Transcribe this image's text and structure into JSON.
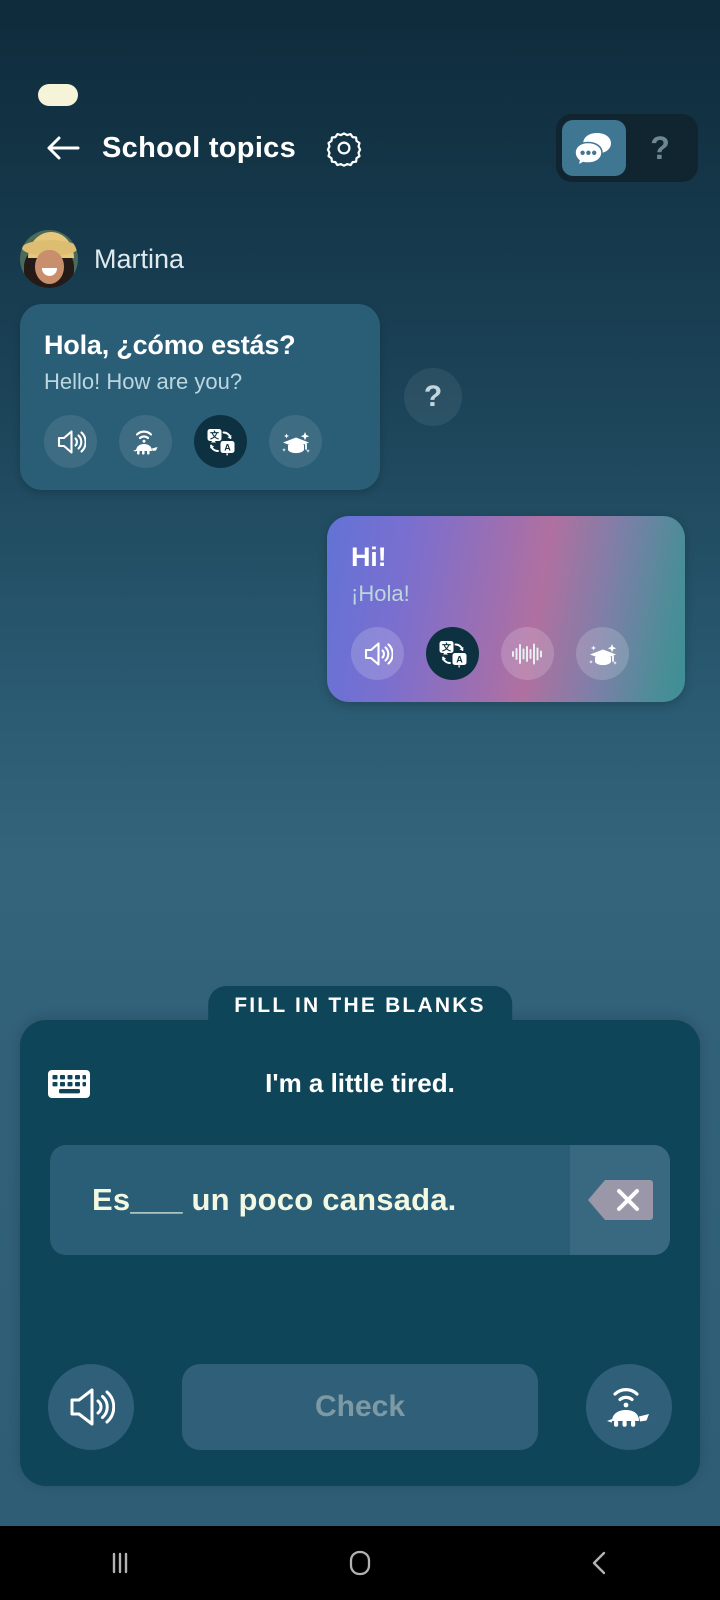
{
  "header": {
    "back_icon": "arrow-left-icon",
    "title": "School topics",
    "settings_icon": "gear-icon",
    "mode_chat_icon": "chat-bubbles-icon",
    "mode_help_label": "?"
  },
  "status_bar": {
    "pill_color": "#f5f3d8"
  },
  "chat": {
    "npc": {
      "avatar_name": "martina-avatar",
      "name": "Martina",
      "primary": "Hola, ¿cómo estás?",
      "secondary": "Hello! How are you?",
      "actions": [
        {
          "name": "speaker-icon",
          "active": false
        },
        {
          "name": "turtle-slow-icon",
          "active": false
        },
        {
          "name": "translate-icon",
          "active": true
        },
        {
          "name": "graduation-cap-sparkle-icon",
          "active": false
        }
      ],
      "help_label": "?"
    },
    "user": {
      "primary": "Hi!",
      "secondary": "¡Hola!",
      "actions": [
        {
          "name": "speaker-icon",
          "active": false
        },
        {
          "name": "translate-icon",
          "active": true
        },
        {
          "name": "waveform-icon",
          "active": false
        },
        {
          "name": "graduation-cap-sparkle-icon",
          "active": false
        }
      ]
    }
  },
  "exercise": {
    "tab_label": "FILL IN THE BLANKS",
    "keyboard_icon": "keyboard-icon",
    "prompt_en": "I'm a little tired.",
    "answer_value": "Es___ un poco cansada.",
    "backspace_icon": "backspace-icon",
    "speaker_icon": "speaker-icon",
    "check_label": "Check",
    "turtle_icon": "turtle-slow-icon"
  },
  "navbar": {
    "recents_icon": "recents-icon",
    "home_icon": "home-icon",
    "back_icon": "back-icon"
  },
  "colors": {
    "bg_top": "#123243",
    "bg_mid": "#34647c",
    "panel": "#0f4558",
    "bubble_npc": "#2a5e77",
    "accent_active": "#3f7793",
    "check_bg": "#2f5f79",
    "check_text": "#7d9aa4",
    "answer_text": "#f3f8e2"
  }
}
